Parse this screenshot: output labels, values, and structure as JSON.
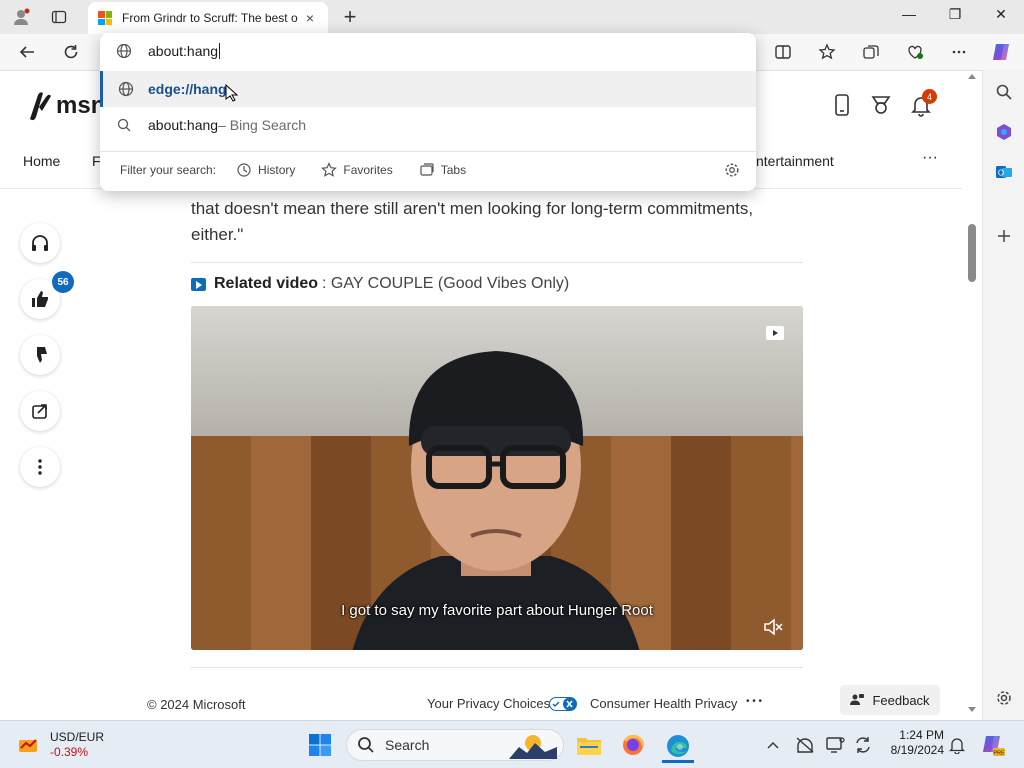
{
  "browser": {
    "tab_title": "From Grindr to Scruff: The best o",
    "tab_close": "×",
    "new_tab": "+",
    "window_controls": [
      "—",
      "❐",
      "✕"
    ]
  },
  "omnibox": {
    "input_value": "about:hang",
    "suggestions": [
      {
        "text": "edge://hang",
        "suffix": "",
        "icon": "globe-icon"
      },
      {
        "text": "about:hang",
        "suffix": " – Bing Search",
        "icon": "search-icon"
      }
    ],
    "filter_label": "Filter your search:",
    "filters": [
      "History",
      "Favorites",
      "Tabs"
    ]
  },
  "msn": {
    "logo_text": "msn",
    "nav": [
      "Home",
      "F",
      "ntertainment"
    ],
    "notifications_badge": "4"
  },
  "rail": {
    "like_count": "56"
  },
  "article": {
    "paragraph": "that doesn't mean there still aren't men looking for long-term commitments, either.\"",
    "related_label": "Related video",
    "related_title": ": GAY COUPLE (Good Vibes Only)",
    "video_caption": "I got to say my favorite part about Hunger Root"
  },
  "footer": {
    "copyright": "© 2024 Microsoft",
    "privacy": "Your Privacy Choices",
    "consumer": "Consumer Health Privacy",
    "more": "• • •",
    "feedback": "Feedback"
  },
  "taskbar": {
    "ticker_name": "USD/EUR",
    "ticker_change": "-0.39%",
    "search_placeholder": "Search",
    "time": "1:24 PM",
    "date": "8/19/2024"
  },
  "colors": {
    "accent": "#0f6cbd",
    "negative": "#c50f1f",
    "badge": "#d83b01"
  }
}
